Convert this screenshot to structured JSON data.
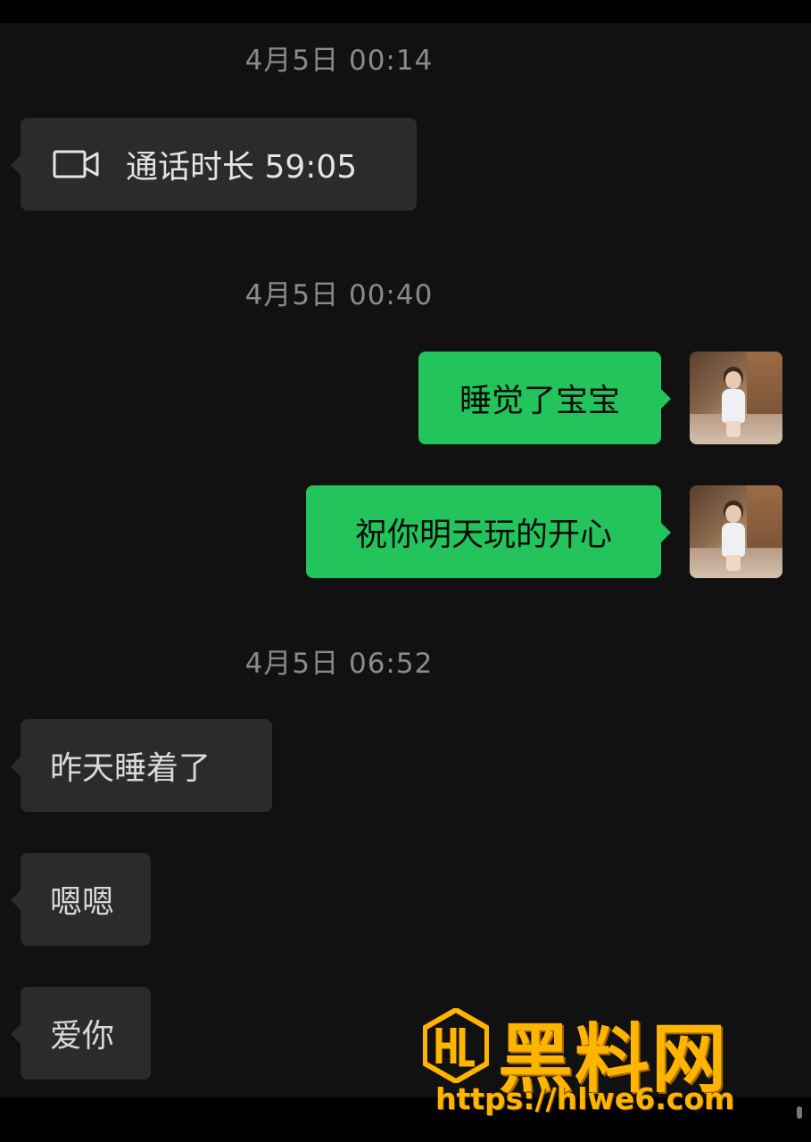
{
  "messages": [
    {
      "type": "timestamp",
      "text": "4月5日 00:14"
    },
    {
      "type": "call",
      "direction": "in",
      "icon": "video-camera-icon",
      "text": "通话时长 59:05"
    },
    {
      "type": "timestamp",
      "text": "4月5日 00:40"
    },
    {
      "type": "text",
      "direction": "out",
      "text": "睡觉了宝宝"
    },
    {
      "type": "text",
      "direction": "out",
      "text": "祝你明天玩的开心"
    },
    {
      "type": "timestamp",
      "text": "4月5日 06:52"
    },
    {
      "type": "text",
      "direction": "in",
      "text": "昨天睡着了"
    },
    {
      "type": "text",
      "direction": "in",
      "text": "嗯嗯"
    },
    {
      "type": "text",
      "direction": "in",
      "text": "爱你"
    }
  ],
  "watermark": {
    "brand": "黑料网",
    "url": "https://hlwe6.com",
    "logo": "HL"
  },
  "colors": {
    "background": "#111111",
    "incoming_bubble": "#2b2b2b",
    "outgoing_bubble": "#23c45b",
    "timestamp": "#8a8a8a",
    "watermark": "#ffb400"
  }
}
